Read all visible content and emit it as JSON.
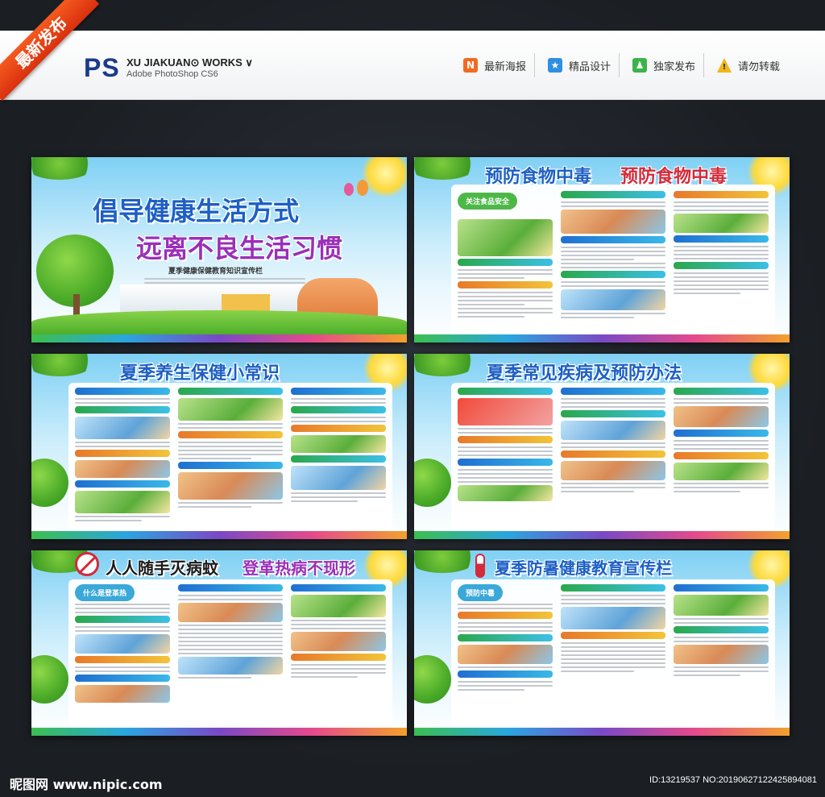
{
  "ribbon": "最新发布",
  "logo": {
    "mark": "PS",
    "title": "XU JIAKUAN⊙ WORKS ∨",
    "subtitle": "Adobe PhotoShop CS6"
  },
  "nav": [
    {
      "icon": "N",
      "label": "最新海报",
      "color": "#f26a21"
    },
    {
      "icon": "★",
      "label": "精品设计",
      "color": "#2f8fe0"
    },
    {
      "icon": "♟",
      "label": "独家发布",
      "color": "#3bb34a"
    },
    {
      "icon": "!",
      "label": "请勿转载",
      "color": "#f2b51a"
    }
  ],
  "panels": {
    "p1": {
      "title1": "倡导健康生活方式",
      "title2": "远离不良生活习惯",
      "subtitle": "夏季健康保健教育知识宣传栏"
    },
    "p2": {
      "title_a": "预防食物中毒",
      "title_b": "预防食物中毒",
      "tag": "关注食品安全"
    },
    "p3": {
      "title": "夏季养生保健小常识"
    },
    "p4": {
      "title": "夏季常见疾病及预防办法"
    },
    "p5": {
      "title_a": "人人随手灭病蚊",
      "title_b": "登革热病不现形",
      "tag": "什么是登革热"
    },
    "p6": {
      "title": "夏季防暑健康教育宣传栏",
      "tag": "预防中暑"
    }
  },
  "footer": {
    "logo": "昵图网 www.nipic.com",
    "id": "ID:13219537 NO:20190627122425894081"
  }
}
